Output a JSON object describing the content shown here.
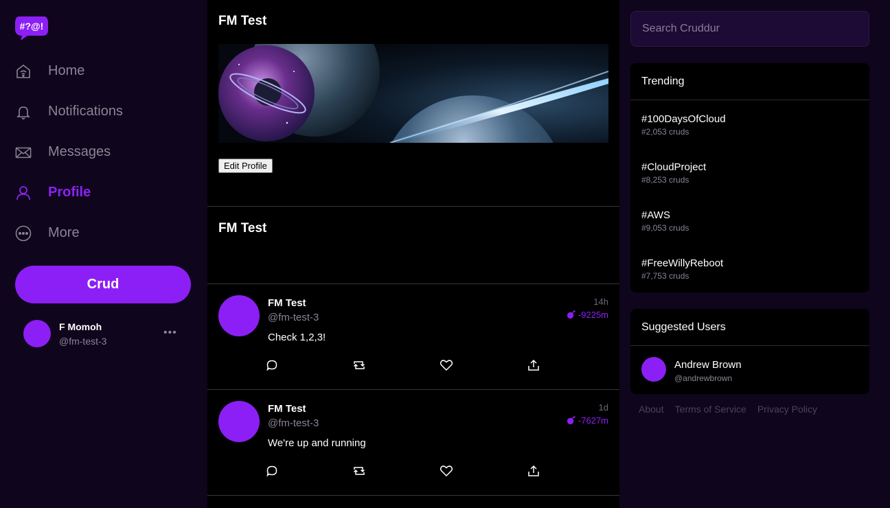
{
  "logo": {
    "text": "#?@!",
    "color": "#8c1ff5"
  },
  "nav": {
    "items": [
      {
        "label": "Home",
        "icon": "home-icon",
        "active": false
      },
      {
        "label": "Notifications",
        "icon": "bell-icon",
        "active": false
      },
      {
        "label": "Messages",
        "icon": "mail-icon",
        "active": false
      },
      {
        "label": "Profile",
        "icon": "user-icon",
        "active": true
      },
      {
        "label": "More",
        "icon": "more-icon",
        "active": false
      }
    ],
    "crud_button": "Crud"
  },
  "current_user": {
    "name": "F Momoh",
    "handle": "@fm-test-3",
    "more": "•••"
  },
  "profile": {
    "title": "FM Test",
    "edit_button": "Edit Profile",
    "section_title": "FM Test"
  },
  "posts": [
    {
      "name": "FM Test",
      "handle": "@fm-test-3",
      "text": "Check 1,2,3!",
      "time": "14h",
      "expires": "-9225m"
    },
    {
      "name": "FM Test",
      "handle": "@fm-test-3",
      "text": "We're up and running",
      "time": "1d",
      "expires": "-7627m"
    }
  ],
  "search": {
    "placeholder": "Search Cruddur"
  },
  "trending": {
    "title": "Trending",
    "items": [
      {
        "tag": "#100DaysOfCloud",
        "count": "#2,053 cruds"
      },
      {
        "tag": "#CloudProject",
        "count": "#8,253 cruds"
      },
      {
        "tag": "#AWS",
        "count": "#9,053 cruds"
      },
      {
        "tag": "#FreeWillyReboot",
        "count": "#7,753 cruds"
      }
    ]
  },
  "suggested": {
    "title": "Suggested Users",
    "users": [
      {
        "name": "Andrew Brown",
        "handle": "@andrewbrown"
      }
    ]
  },
  "footer": {
    "links": [
      "About",
      "Terms of Service",
      "Privacy Policy"
    ]
  },
  "colors": {
    "accent": "#8c1ff5",
    "sidebar_bg": "#0f051c",
    "muted": "#8c8494"
  }
}
